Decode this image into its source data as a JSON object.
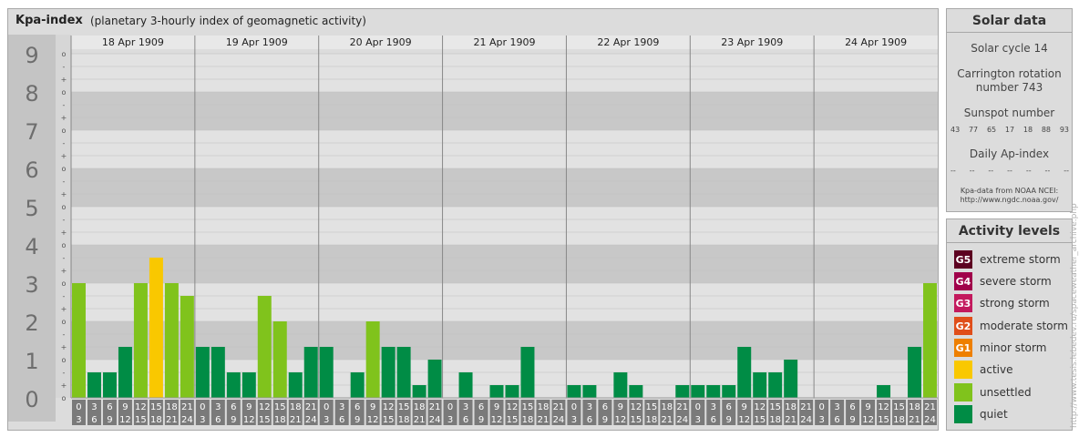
{
  "header": {
    "title": "Kpa-index",
    "subtitle": "(planetary 3-hourly index of geomagnetic activity)"
  },
  "colors": {
    "background_band_dark": "#c8c8c8",
    "background_band_light": "#e2e2e2",
    "quiet": "#008c45",
    "unsettled": "#80c31c",
    "active": "#f9c800",
    "minor_storm": "#ee7f00",
    "moderate_storm": "#e04e1a",
    "strong_storm": "#c3195d",
    "severe_storm": "#a0004a",
    "extreme_storm": "#5c0020",
    "tick_box": "#7a7a7a"
  },
  "chart_data": {
    "type": "bar",
    "title": "Kpa-index",
    "subtitle": "(planetary 3-hourly index of geomagnetic activity)",
    "ylim": [
      0,
      9
    ],
    "y_ticks": [
      "0",
      "1",
      "2",
      "3",
      "4",
      "5",
      "6",
      "7",
      "8",
      "9"
    ],
    "y_minor_labels": [
      "o",
      "+",
      "-",
      "o"
    ],
    "days": [
      "18 Apr 1909",
      "19 Apr 1909",
      "20 Apr 1909",
      "21 Apr 1909",
      "22 Apr 1909",
      "23 Apr 1909",
      "24 Apr 1909"
    ],
    "interval_labels": [
      [
        "0",
        "3"
      ],
      [
        "3",
        "6"
      ],
      [
        "6",
        "9"
      ],
      [
        "9",
        "12"
      ],
      [
        "12",
        "15"
      ],
      [
        "15",
        "18"
      ],
      [
        "18",
        "21"
      ],
      [
        "21",
        "24"
      ]
    ],
    "values": [
      [
        3.0,
        0.667,
        0.667,
        1.333,
        3.0,
        3.667,
        3.0,
        2.667
      ],
      [
        1.333,
        1.333,
        0.667,
        0.667,
        2.667,
        2.0,
        0.667,
        1.333
      ],
      [
        1.333,
        0.0,
        0.667,
        2.0,
        1.333,
        1.333,
        0.333,
        1.0
      ],
      [
        0.0,
        0.667,
        0.0,
        0.333,
        0.333,
        1.333,
        0.0,
        0.0
      ],
      [
        0.333,
        0.333,
        0.0,
        0.667,
        0.333,
        0.0,
        0.0,
        0.333
      ],
      [
        0.333,
        0.333,
        0.333,
        1.333,
        0.667,
        0.667,
        1.0,
        0.0
      ],
      [
        0.0,
        0.0,
        0.0,
        0.0,
        0.333,
        0.0,
        1.333,
        3.0
      ]
    ],
    "grid": true
  },
  "solar_data": {
    "title": "Solar data",
    "cycle": "Solar cycle 14",
    "carrington_line1": "Carrington rotation",
    "carrington_line2": "number 743",
    "sunspot_label": "Sunspot number",
    "sunspot_values": [
      "43",
      "77",
      "65",
      "17",
      "18",
      "88",
      "93"
    ],
    "ap_label": "Daily Ap-index",
    "ap_values": [
      "--",
      "--",
      "--",
      "--",
      "--",
      "--",
      "--"
    ],
    "source_line1": "Kpa-data from NOAA NCEI:",
    "source_line2": "http://www.ngdc.noaa.gov/"
  },
  "activity_levels": {
    "title": "Activity levels",
    "items": [
      {
        "badge": "G5",
        "label": "extreme storm",
        "color": "#5c0020"
      },
      {
        "badge": "G4",
        "label": "severe storm",
        "color": "#a0004a"
      },
      {
        "badge": "G3",
        "label": "strong storm",
        "color": "#c3195d"
      },
      {
        "badge": "G2",
        "label": "moderate storm",
        "color": "#e04e1a"
      },
      {
        "badge": "G1",
        "label": "minor storm",
        "color": "#ee7f00"
      },
      {
        "badge": "",
        "label": "active",
        "color": "#f9c800"
      },
      {
        "badge": "",
        "label": "unsettled",
        "color": "#80c31c"
      },
      {
        "badge": "",
        "label": "quiet",
        "color": "#008c45"
      }
    ]
  },
  "watermark": "http://www.tesis.lebedev.ru/spaceweather_archive.php"
}
